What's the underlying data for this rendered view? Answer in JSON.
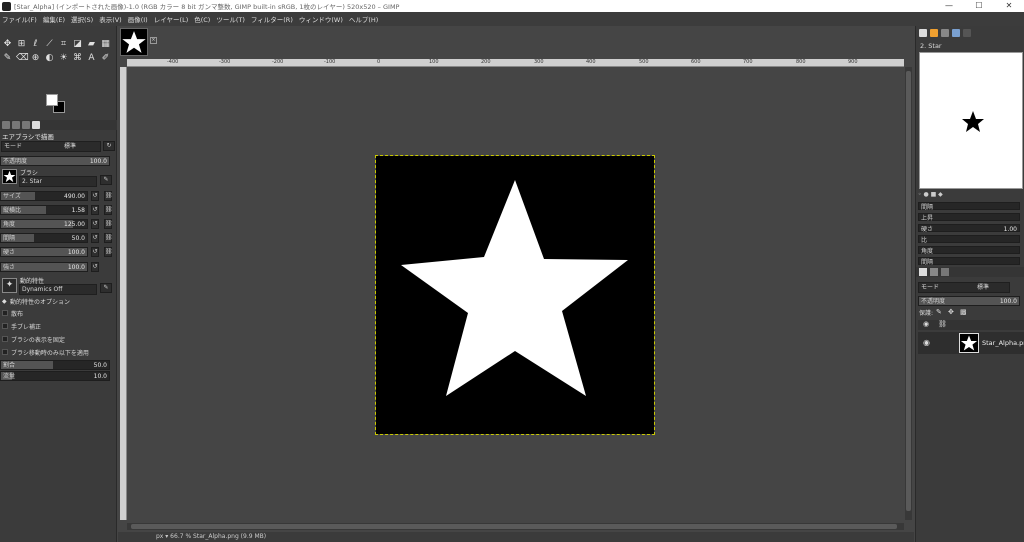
{
  "window": {
    "title": "[Star_Alpha] (インポートされた画像)-1.0 (RGB カラー 8 bit ガンマ整数, GIMP built-in sRGB, 1枚のレイヤー) 520x520 – GIMP",
    "controls": [
      "—",
      "☐",
      "✕"
    ]
  },
  "menu": [
    "ファイル(F)",
    "編集(E)",
    "選択(S)",
    "表示(V)",
    "画像(I)",
    "レイヤー(L)",
    "色(C)",
    "ツール(T)",
    "フィルター(R)",
    "ウィンドウ(W)",
    "ヘルプ(H)"
  ],
  "tool_options": {
    "title": "エアブラシで描画",
    "mode_label": "モード",
    "mode_value": "標準",
    "opacity_label": "不透明度",
    "opacity_value": "100.0",
    "brush_label": "ブラシ",
    "brush_value": "2. Star",
    "size_label": "サイズ",
    "size_value": "490.00",
    "aspect_label": "縦横比",
    "aspect_value": "1.58",
    "angle_label": "角度",
    "angle_value": "125.00",
    "spacing_label": "間隔",
    "spacing_value": "50.0",
    "hardness_label": "硬さ",
    "hardness_value": "100.0",
    "force_label": "強さ",
    "force_value": "100.0",
    "dynamics_label": "動的特性",
    "dynamics_value": "Dynamics Off",
    "dynamics_options": "動的特性のオプション",
    "jitter": "散布",
    "smooth": "手ブレ補正",
    "lock_view": "ブラシの表示を固定",
    "incremental": "ブラシ移動時のみ以下を適用",
    "rate_label": "割合",
    "rate_value": "50.0",
    "flow_label": "流量",
    "flow_value": "10.0"
  },
  "ruler": {
    "ticks": [
      "-400",
      "-300",
      "-200",
      "-100",
      "0",
      "100",
      "200",
      "300",
      "400",
      "500",
      "600",
      "700",
      "800",
      "900"
    ]
  },
  "status": "px ▾  66.7 %  Star_Alpha.png (9.9 MB)",
  "right_panel": {
    "brush_name": "2. Star",
    "brush_props": [
      "間隔",
      "上昇",
      "硬さ",
      "比",
      "角度",
      "間隔"
    ],
    "hardness_value": "1.00",
    "layers_mode_label": "モード",
    "layers_mode_value": "標準",
    "layers_opacity_label": "不透明度",
    "layers_opacity_value": "100.0",
    "lock_label": "保護:",
    "layer_name": "Star_Alpha.png"
  }
}
